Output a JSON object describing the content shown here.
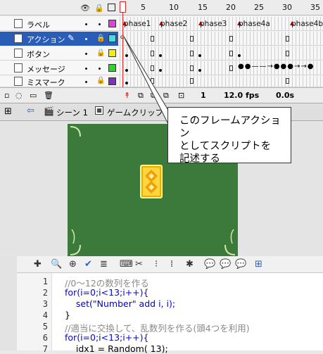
{
  "timeline": {
    "frame_numbers": [
      "1",
      "5",
      "10",
      "15",
      "20",
      "25",
      "30",
      "35"
    ],
    "layers": [
      {
        "name": "ラベル",
        "color": "#e040e0",
        "selected": false
      },
      {
        "name": "アクション",
        "color": "#44dede",
        "selected": true
      },
      {
        "name": "ボタン",
        "color": "#f0f000",
        "selected": false
      },
      {
        "name": "メッセージ",
        "color": "#30d030",
        "selected": false
      },
      {
        "name": "ミスマーク",
        "color": "#8030c0",
        "selected": false
      }
    ],
    "frame_labels": [
      "phase1",
      "phase2",
      "phase3",
      "phase4a",
      "phase4b"
    ],
    "footer": {
      "current_frame": "1",
      "fps": "12.0 fps",
      "time": "0.0s"
    }
  },
  "scene_bar": {
    "scene": "シーン 1",
    "clip": "ゲームクリップ"
  },
  "callout": {
    "lines": [
      "このフレームアクション",
      "としてスクリプトを",
      "記述する"
    ]
  },
  "code": {
    "line_numbers": [
      "1",
      "2",
      "3",
      "4",
      "5",
      "6",
      "7"
    ],
    "lines": [
      "//0～12の数列を作る",
      "for(i=0;i<13;i++){",
      "    set(\"Number\" add i, i);",
      "}",
      "//適当に交換して、乱数列を作る(頭4つを利用)",
      "for(i=0;i<13;i++){",
      "    idx1 = Random( 13);"
    ]
  }
}
